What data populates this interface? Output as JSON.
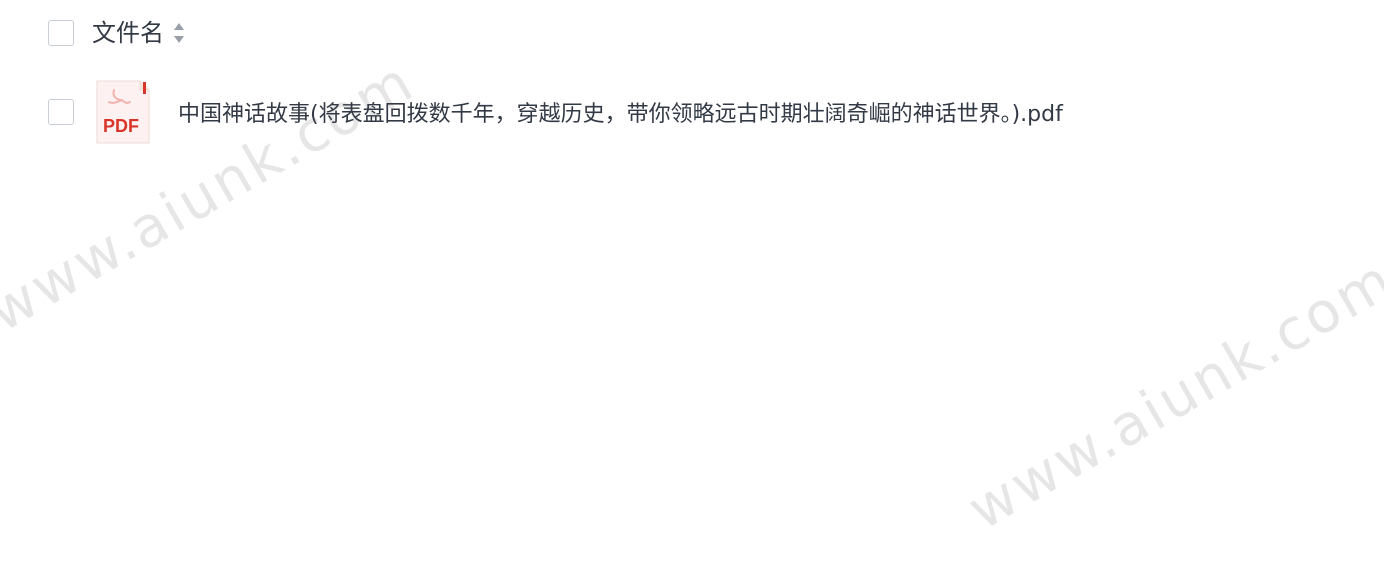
{
  "header": {
    "column_title": "文件名"
  },
  "files": [
    {
      "type_label": "PDF",
      "name": "中国神话故事(将表盘回拨数千年，穿越历史，带你领略远古时期壮阔奇崛的神话世界。).pdf"
    }
  ],
  "watermark": {
    "text": "www.aiunk.com"
  },
  "colors": {
    "text": "#333a45",
    "checkbox_border": "#c9ced6",
    "pdf_red": "#d9362b",
    "watermark": "#e6e6e6"
  },
  "icons": {
    "sort": "sort-icon",
    "pdf": "pdf-file-icon"
  }
}
